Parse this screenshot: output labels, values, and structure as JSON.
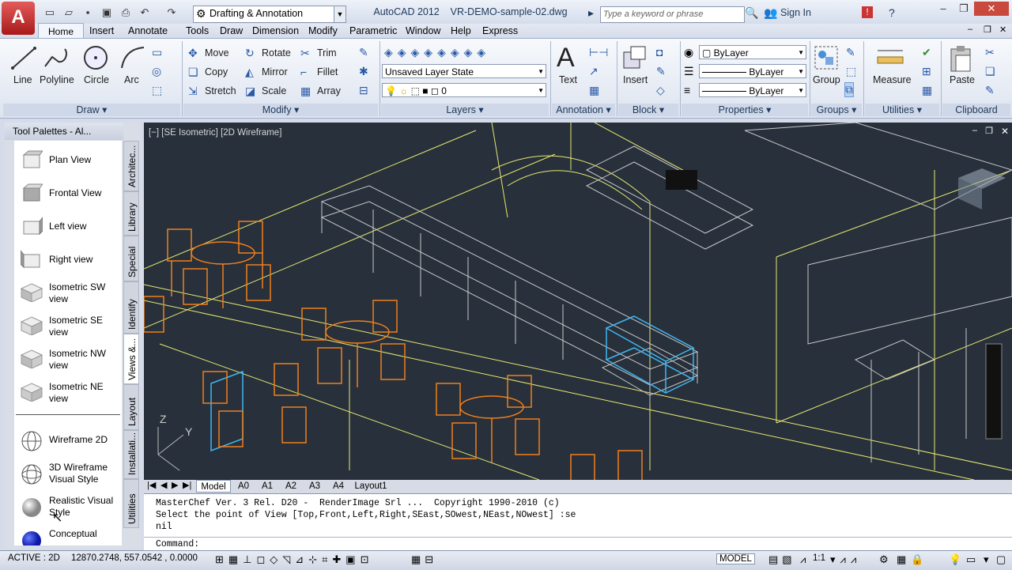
{
  "title_bar": {
    "app_letter": "A",
    "workspace": "Drafting & Annotation",
    "app_name": "AutoCAD 2012",
    "document": "VR-DEMO-sample-02.dwg",
    "search_placeholder": "Type a keyword or phrase",
    "sign_in": "Sign In"
  },
  "ribbon_tabs": [
    "Home",
    "Insert",
    "Annotate"
  ],
  "menus": [
    "Tools",
    "Draw",
    "Dimension",
    "Modify",
    "Parametric",
    "Window",
    "Help",
    "Express"
  ],
  "draw_panel": {
    "tools": [
      "Line",
      "Polyline",
      "Circle",
      "Arc"
    ],
    "label": "Draw"
  },
  "modify_panel": {
    "tools": [
      "Move",
      "Rotate",
      "Trim",
      "Copy",
      "Mirror",
      "Fillet",
      "Stretch",
      "Scale",
      "Array"
    ],
    "label": "Modify"
  },
  "layers_panel": {
    "layer_state": "Unsaved Layer State",
    "current_layer": "0",
    "label": "Layers"
  },
  "annotation_panel": {
    "text_tool": "Text",
    "label": "Annotation"
  },
  "block_panel": {
    "insert_tool": "Insert",
    "label": "Block"
  },
  "properties_panel": {
    "color": "ByLayer",
    "linetype": "ByLayer",
    "lineweight": "ByLayer",
    "label": "Properties"
  },
  "groups_panel": {
    "group_tool": "Group",
    "label": "Groups"
  },
  "utilities_panel": {
    "measure_tool": "Measure",
    "label": "Utilities"
  },
  "clipboard_panel": {
    "paste_tool": "Paste",
    "label": "Clipboard"
  },
  "tool_palette": {
    "title": "Tool Palettes - Al...",
    "items": [
      {
        "label1": "Plan View",
        "label2": ""
      },
      {
        "label1": "Frontal View",
        "label2": ""
      },
      {
        "label1": "Left view",
        "label2": ""
      },
      {
        "label1": "Right view",
        "label2": ""
      },
      {
        "label1": "Isometric SW",
        "label2": "view"
      },
      {
        "label1": "Isometric SE",
        "label2": "view"
      },
      {
        "label1": "Isometric NW",
        "label2": "view"
      },
      {
        "label1": "Isometric NE",
        "label2": "view"
      },
      {
        "label1": "Wireframe 2D",
        "label2": ""
      },
      {
        "label1": "3D Wireframe",
        "label2": "Visual Style"
      },
      {
        "label1": "Realistic Visual",
        "label2": "Style"
      },
      {
        "label1": "Conceptual",
        "label2": ""
      }
    ],
    "side_tabs": [
      "Architec...",
      "Library",
      "Special",
      "Identify",
      "Views &...",
      "Layout",
      "Installati...",
      "Utilities"
    ]
  },
  "viewport": {
    "label": "[−] [SE Isometric] [2D Wireframe]"
  },
  "layout_tabs": [
    "Model",
    "A0",
    "A1",
    "A2",
    "A3",
    "A4",
    "Layout1"
  ],
  "command_lines": [
    "MasterChef Ver. 3 Rel. D20 -  RenderImage Srl ...  Copyright 1990-2010 (c)",
    "Select the point of View [Top,Front,Left,Right,SEast,SOwest,NEast,NOwest] :se",
    "nil",
    "Command:"
  ],
  "status_bar": {
    "mode": "ACTIVE : 2D",
    "coordinates": "12870.2748, 557.0542 , 0.0000",
    "space": "MODEL",
    "scale": "1:1"
  },
  "colors": {
    "viewport_bg": "#27303b",
    "chairs": "#f07f1c",
    "walls": "#e8e870",
    "equipment": "#c8c8c8",
    "selected": "#3fb6f2"
  }
}
